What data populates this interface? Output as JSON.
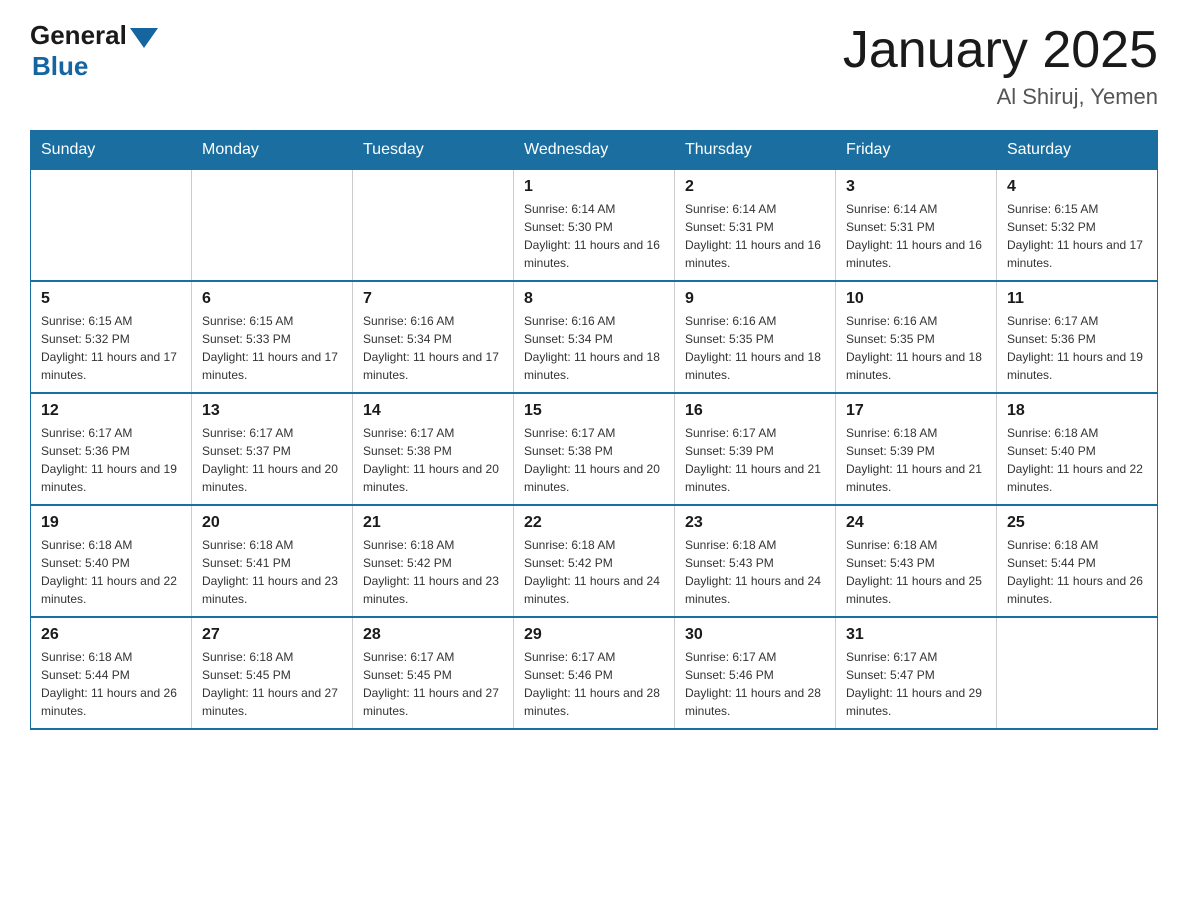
{
  "header": {
    "logo_general": "General",
    "logo_blue": "Blue",
    "title": "January 2025",
    "subtitle": "Al Shiruj, Yemen"
  },
  "days_of_week": [
    "Sunday",
    "Monday",
    "Tuesday",
    "Wednesday",
    "Thursday",
    "Friday",
    "Saturday"
  ],
  "weeks": [
    [
      {
        "day": "",
        "info": ""
      },
      {
        "day": "",
        "info": ""
      },
      {
        "day": "",
        "info": ""
      },
      {
        "day": "1",
        "info": "Sunrise: 6:14 AM\nSunset: 5:30 PM\nDaylight: 11 hours and 16 minutes."
      },
      {
        "day": "2",
        "info": "Sunrise: 6:14 AM\nSunset: 5:31 PM\nDaylight: 11 hours and 16 minutes."
      },
      {
        "day": "3",
        "info": "Sunrise: 6:14 AM\nSunset: 5:31 PM\nDaylight: 11 hours and 16 minutes."
      },
      {
        "day": "4",
        "info": "Sunrise: 6:15 AM\nSunset: 5:32 PM\nDaylight: 11 hours and 17 minutes."
      }
    ],
    [
      {
        "day": "5",
        "info": "Sunrise: 6:15 AM\nSunset: 5:32 PM\nDaylight: 11 hours and 17 minutes."
      },
      {
        "day": "6",
        "info": "Sunrise: 6:15 AM\nSunset: 5:33 PM\nDaylight: 11 hours and 17 minutes."
      },
      {
        "day": "7",
        "info": "Sunrise: 6:16 AM\nSunset: 5:34 PM\nDaylight: 11 hours and 17 minutes."
      },
      {
        "day": "8",
        "info": "Sunrise: 6:16 AM\nSunset: 5:34 PM\nDaylight: 11 hours and 18 minutes."
      },
      {
        "day": "9",
        "info": "Sunrise: 6:16 AM\nSunset: 5:35 PM\nDaylight: 11 hours and 18 minutes."
      },
      {
        "day": "10",
        "info": "Sunrise: 6:16 AM\nSunset: 5:35 PM\nDaylight: 11 hours and 18 minutes."
      },
      {
        "day": "11",
        "info": "Sunrise: 6:17 AM\nSunset: 5:36 PM\nDaylight: 11 hours and 19 minutes."
      }
    ],
    [
      {
        "day": "12",
        "info": "Sunrise: 6:17 AM\nSunset: 5:36 PM\nDaylight: 11 hours and 19 minutes."
      },
      {
        "day": "13",
        "info": "Sunrise: 6:17 AM\nSunset: 5:37 PM\nDaylight: 11 hours and 20 minutes."
      },
      {
        "day": "14",
        "info": "Sunrise: 6:17 AM\nSunset: 5:38 PM\nDaylight: 11 hours and 20 minutes."
      },
      {
        "day": "15",
        "info": "Sunrise: 6:17 AM\nSunset: 5:38 PM\nDaylight: 11 hours and 20 minutes."
      },
      {
        "day": "16",
        "info": "Sunrise: 6:17 AM\nSunset: 5:39 PM\nDaylight: 11 hours and 21 minutes."
      },
      {
        "day": "17",
        "info": "Sunrise: 6:18 AM\nSunset: 5:39 PM\nDaylight: 11 hours and 21 minutes."
      },
      {
        "day": "18",
        "info": "Sunrise: 6:18 AM\nSunset: 5:40 PM\nDaylight: 11 hours and 22 minutes."
      }
    ],
    [
      {
        "day": "19",
        "info": "Sunrise: 6:18 AM\nSunset: 5:40 PM\nDaylight: 11 hours and 22 minutes."
      },
      {
        "day": "20",
        "info": "Sunrise: 6:18 AM\nSunset: 5:41 PM\nDaylight: 11 hours and 23 minutes."
      },
      {
        "day": "21",
        "info": "Sunrise: 6:18 AM\nSunset: 5:42 PM\nDaylight: 11 hours and 23 minutes."
      },
      {
        "day": "22",
        "info": "Sunrise: 6:18 AM\nSunset: 5:42 PM\nDaylight: 11 hours and 24 minutes."
      },
      {
        "day": "23",
        "info": "Sunrise: 6:18 AM\nSunset: 5:43 PM\nDaylight: 11 hours and 24 minutes."
      },
      {
        "day": "24",
        "info": "Sunrise: 6:18 AM\nSunset: 5:43 PM\nDaylight: 11 hours and 25 minutes."
      },
      {
        "day": "25",
        "info": "Sunrise: 6:18 AM\nSunset: 5:44 PM\nDaylight: 11 hours and 26 minutes."
      }
    ],
    [
      {
        "day": "26",
        "info": "Sunrise: 6:18 AM\nSunset: 5:44 PM\nDaylight: 11 hours and 26 minutes."
      },
      {
        "day": "27",
        "info": "Sunrise: 6:18 AM\nSunset: 5:45 PM\nDaylight: 11 hours and 27 minutes."
      },
      {
        "day": "28",
        "info": "Sunrise: 6:17 AM\nSunset: 5:45 PM\nDaylight: 11 hours and 27 minutes."
      },
      {
        "day": "29",
        "info": "Sunrise: 6:17 AM\nSunset: 5:46 PM\nDaylight: 11 hours and 28 minutes."
      },
      {
        "day": "30",
        "info": "Sunrise: 6:17 AM\nSunset: 5:46 PM\nDaylight: 11 hours and 28 minutes."
      },
      {
        "day": "31",
        "info": "Sunrise: 6:17 AM\nSunset: 5:47 PM\nDaylight: 11 hours and 29 minutes."
      },
      {
        "day": "",
        "info": ""
      }
    ]
  ]
}
